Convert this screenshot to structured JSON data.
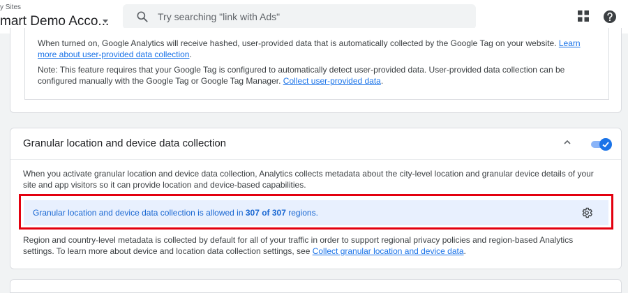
{
  "header": {
    "breadcrumb": "y Sites",
    "account_name": "mart Demo Acco...",
    "search": {
      "placeholder": "Try searching \"link with Ads\"",
      "value": ""
    },
    "icons": [
      "search-icon",
      "apps-grid-icon",
      "help-icon"
    ]
  },
  "user_provided_card": {
    "p1_text": "When turned on, Google Analytics will receive hashed, user-provided data that is automatically collected by the Google Tag on your website. ",
    "p1_link": "Learn more about user-provided data collection",
    "p1_end": ".",
    "p2_text": "Note: This feature requires that your Google Tag is configured to automatically detect user-provided data. User-provided data collection can be configured manually with the Google Tag or Google Tag Manager. ",
    "p2_link": "Collect user-provided data",
    "p2_end": "."
  },
  "granular_card": {
    "title": "Granular location and device data collection",
    "toggle_on": true,
    "description": "When you activate granular location and device data collection, Analytics collects metadata about the city-level location and granular device details of your site and app visitors so it can provide location and device-based capabilities.",
    "banner_prefix": "Granular location and device data collection is allowed in ",
    "banner_count": "307 of 307",
    "banner_suffix": " regions.",
    "footer_text": "Region and country-level metadata is collected by default for all of your traffic in order to support regional privacy policies and region-based Analytics settings. To learn more about device and location data collection settings, see ",
    "footer_link": "Collect granular location and device data",
    "footer_end": "."
  },
  "colors": {
    "accent": "#1a73e8",
    "banner_bg": "#e8f0fe",
    "highlight": "#e3000f",
    "page_bg": "#f1f3f4"
  }
}
